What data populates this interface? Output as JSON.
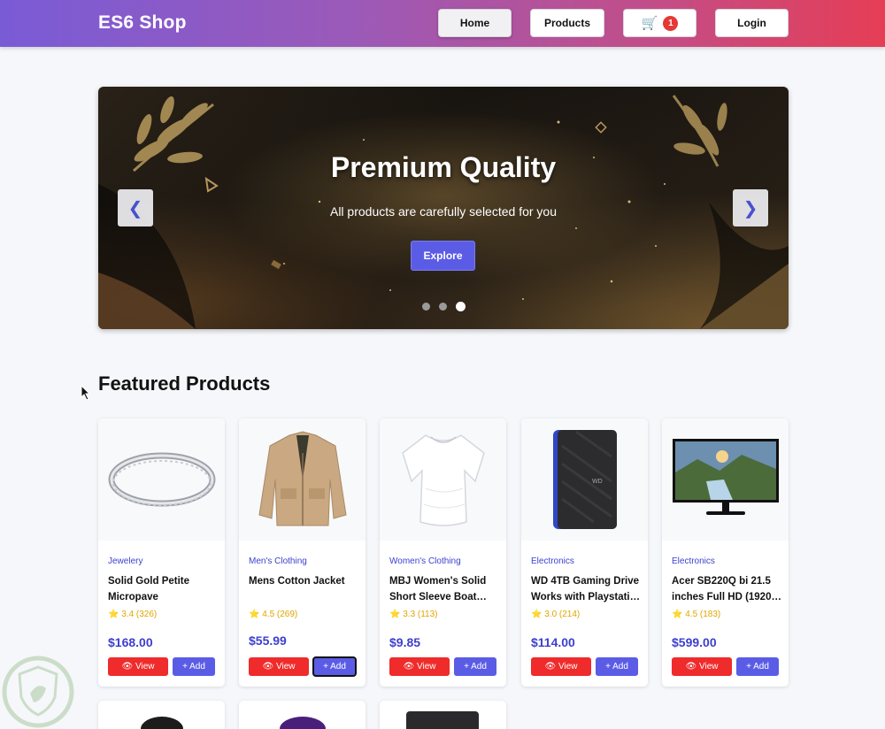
{
  "header": {
    "brand": "ES6 Shop",
    "nav": {
      "home": "Home",
      "products": "Products",
      "cart_count": "1",
      "login": "Login"
    }
  },
  "hero": {
    "title": "Premium Quality",
    "subtitle": "All products are carefully selected for you",
    "button": "Explore",
    "prev": "❮",
    "next": "❯"
  },
  "featured": {
    "title": "Featured Products",
    "view_label": "👁 View",
    "add_label": "+ Add",
    "products": [
      {
        "category": "Jewelery",
        "name": "Solid Gold Petite Micropave",
        "rating": "⭐ 3.4 (326)",
        "price": "$168.00"
      },
      {
        "category": "Men's Clothing",
        "name": "Mens Cotton Jacket",
        "rating": "⭐ 4.5 (269)",
        "price": "$55.99"
      },
      {
        "category": "Women's Clothing",
        "name": "MBJ Women's Solid Short Sleeve Boat…",
        "rating": "⭐ 3.3 (113)",
        "price": "$9.85"
      },
      {
        "category": "Electronics",
        "name": "WD 4TB Gaming Drive Works with Playstati…",
        "rating": "⭐ 3.0 (214)",
        "price": "$114.00"
      },
      {
        "category": "Electronics",
        "name": "Acer SB220Q bi 21.5 inches Full HD (1920…",
        "rating": "⭐ 4.5 (183)",
        "price": "$599.00"
      }
    ]
  },
  "colors": {
    "accent": "#5b5ce6",
    "danger": "#ef2b2b",
    "rating": "#e0a500"
  }
}
